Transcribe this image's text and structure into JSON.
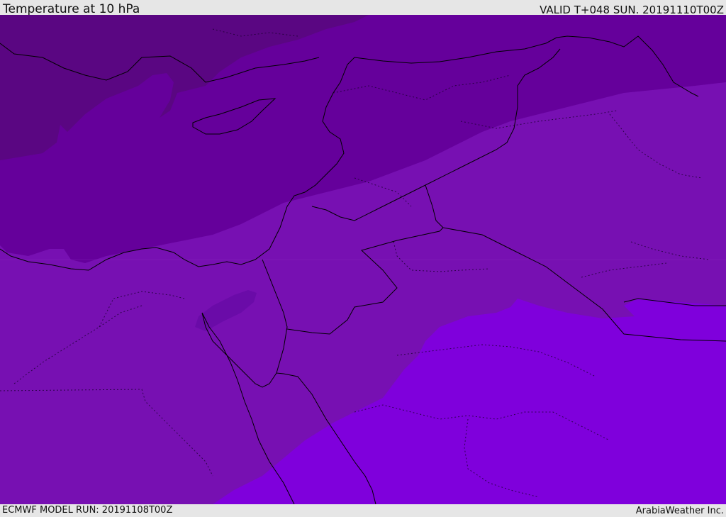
{
  "header": {
    "title": "Temperature at 10 hPa",
    "valid": "VALID T+048 SUN. 20191110T00Z"
  },
  "footer": {
    "model_run": "ECMWF MODEL RUN: 20191108T00Z",
    "credit": "ArabiaWeather Inc."
  },
  "colors": {
    "band_coldest": "#5a0682",
    "band_cold": "#65009b",
    "band_mid": "#7710b2",
    "band_warm": "#7f00dc",
    "band_darkblob": "#6a0ba8",
    "border": "#000000"
  }
}
